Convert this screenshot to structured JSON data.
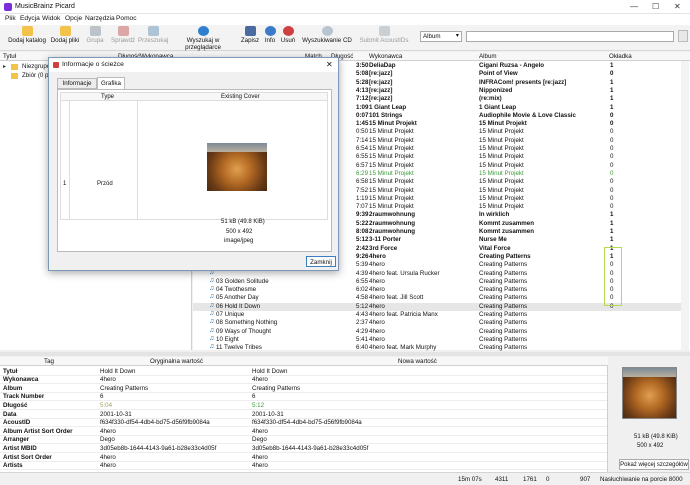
{
  "window": {
    "title": "MusicBrainz Picard"
  },
  "menu": [
    "Plik",
    "Edycja",
    "Widok",
    "Opcje",
    "Narzędzia",
    "Pomoc"
  ],
  "toolbar": {
    "add_folder": "Dodaj katalog",
    "add_files": "Dodaj pliki",
    "cluster": "Grupa",
    "lookup": "Sprawdź",
    "scan": "Przeszukaj",
    "browser_lookup": "Wyszukaj w przeglądarce",
    "save": "Zapisz",
    "info": "Info",
    "remove": "Usuń",
    "cd_lookup": "Wyszukiwanie CD",
    "submit_acoustid": "Submit AcoustIDs",
    "search_type": "Album",
    "search_value": ""
  },
  "left_panel": {
    "headers": [
      "Tytuł",
      "Długość",
      "Wykonawca"
    ],
    "items": [
      "Niezgrupo",
      "Zbiór (0 plików)"
    ]
  },
  "right_panel": {
    "headers": [
      "Tytuł",
      "Długość",
      "Wykonawca",
      "Album",
      "Okładka"
    ],
    "left_headers": [
      "Match",
      "Długość"
    ],
    "albums": [
      {
        "len": "3:50",
        "artist": "DeliaDap",
        "album": "Cigani Ruzsa - Angelo",
        "cover": "1",
        "bold": true
      },
      {
        "len": "5:08",
        "artist": "[re:jazz]",
        "album": "Point of View",
        "cover": "0",
        "bold": true
      },
      {
        "len": "5:28",
        "artist": "[re:jazz]",
        "album": "INFRACom! presents [re:jazz]",
        "cover": "1",
        "bold": true
      },
      {
        "len": "4:13",
        "artist": "[re:jazz]",
        "album": "Nipponized",
        "cover": "1",
        "bold": true
      },
      {
        "len": "7:12",
        "artist": "[re:jazz]",
        "album": "(re:mix)",
        "cover": "1",
        "bold": true
      },
      {
        "len": "1:09",
        "artist": "1 Giant Leap",
        "album": "1 Giant Leap",
        "cover": "1",
        "bold": true
      },
      {
        "len": "0:07",
        "artist": "101 Strings",
        "album": "Audiophile Movie & Love Classic",
        "cover": "0",
        "bold": true
      },
      {
        "len": "1:45",
        "artist": "15 Minut Projekt",
        "album": "15 Minut Projekt",
        "cover": "0",
        "bold": true
      },
      {
        "len": "0:50",
        "artist": "15 Minut Projekt",
        "album": "15 Minut Projekt",
        "cover": "0",
        "bold": false
      },
      {
        "len": "7:14",
        "artist": "15 Minut Projekt",
        "album": "15 Minut Projekt",
        "cover": "0",
        "bold": false
      },
      {
        "len": "6:54",
        "artist": "15 Minut Projekt",
        "album": "15 Minut Projekt",
        "cover": "0",
        "bold": false
      },
      {
        "len": "6:55",
        "artist": "15 Minut Projekt",
        "album": "15 Minut Projekt",
        "cover": "0",
        "bold": false
      },
      {
        "len": "6:57",
        "artist": "15 Minut Projekt",
        "album": "15 Minut Projekt",
        "cover": "0",
        "bold": false
      },
      {
        "len": "6:29",
        "artist": "15 Minut Projekt",
        "album": "15 Minut Projekt",
        "cover": "0",
        "green": true
      },
      {
        "len": "6:58",
        "artist": "15 Minut Projekt",
        "album": "15 Minut Projekt",
        "cover": "0",
        "bold": false
      },
      {
        "len": "7:52",
        "artist": "15 Minut Projekt",
        "album": "15 Minut Projekt",
        "cover": "0",
        "bold": false
      },
      {
        "len": "1:19",
        "artist": "15 Minut Projekt",
        "album": "15 Minut Projekt",
        "cover": "0",
        "bold": false
      },
      {
        "len": "7:07",
        "artist": "15 Minut Projekt",
        "album": "15 Minut Projekt",
        "cover": "0",
        "bold": false
      },
      {
        "len": "9:39",
        "artist": "2raumwohnung",
        "album": "In wirklich",
        "cover": "1",
        "bold": true
      },
      {
        "len": "5:22",
        "artist": "2raumwohnung",
        "album": "Kommt zusammen",
        "cover": "1",
        "bold": true
      },
      {
        "len": "8:08",
        "artist": "2raumwohnung",
        "album": "Kommt zusammen",
        "cover": "1",
        "bold": true
      },
      {
        "len": "5:12",
        "artist": "3-11 Porter",
        "album": "Nurse Me",
        "cover": "1",
        "bold": true
      },
      {
        "len": "2:42",
        "artist": "3rd Force",
        "album": "Vital Force",
        "cover": "1",
        "bold": true
      },
      {
        "len": "9:26",
        "artist": "4hero",
        "album": "Creating Patterns",
        "cover": "1",
        "bold": true
      }
    ],
    "tracks": [
      {
        "title": "",
        "len": "5:39",
        "artist": "4hero",
        "album": "Creating Patterns",
        "cover": "0"
      },
      {
        "title": "",
        "len": "4:39",
        "artist": "4hero feat. Ursula Rucker",
        "album": "Creating Patterns",
        "cover": "0"
      },
      {
        "title": "03  Golden Solitude",
        "len": "6:55",
        "artist": "4hero",
        "album": "Creating Patterns",
        "cover": "0"
      },
      {
        "title": "04  Twothesme",
        "len": "6:02",
        "artist": "4hero",
        "album": "Creating Patterns",
        "cover": "0"
      },
      {
        "title": "05  Another Day",
        "len": "4:58",
        "artist": "4hero feat. Jill Scott",
        "album": "Creating Patterns",
        "cover": "0"
      },
      {
        "title": "06  Hold It Down",
        "len": "5:12",
        "artist": "4hero",
        "album": "Creating Patterns",
        "cover": "0",
        "selected": true
      },
      {
        "title": "07  Unique",
        "len": "4:43",
        "artist": "4hero feat. Patricia Manx",
        "album": "Creating Patterns",
        "cover": ""
      },
      {
        "title": "08  Something Nothing",
        "len": "2:37",
        "artist": "4hero",
        "album": "Creating Patterns",
        "cover": ""
      },
      {
        "title": "09  Ways of Thought",
        "len": "4:29",
        "artist": "4hero",
        "album": "Creating Patterns",
        "cover": ""
      },
      {
        "title": "10  Eight",
        "len": "5:41",
        "artist": "4hero",
        "album": "Creating Patterns",
        "cover": ""
      },
      {
        "title": "11  Twelve Tribes",
        "len": "6:40",
        "artist": "4hero feat. Mark Murphy",
        "album": "Creating Patterns",
        "cover": ""
      }
    ]
  },
  "dialog": {
    "title": "Informacje o ścieżce",
    "tabs": [
      "Informacje",
      "Grafika"
    ],
    "col_type": "Type",
    "col_cover": "Existing Cover",
    "row_index": "1",
    "row_type": "Przód",
    "cover_size": "51 kB (49.8 KiB)",
    "cover_dims": "500 x 492",
    "cover_mime": "image/jpeg",
    "close": "Zamknij"
  },
  "metadata": {
    "headers": [
      "Tag",
      "Oryginalna wartość",
      "Nowa wartość"
    ],
    "rows": [
      [
        "Tytuł",
        "Hold It Down",
        "Hold It Down"
      ],
      [
        "Wykonawca",
        "4hero",
        "4hero"
      ],
      [
        "Album",
        "Creating Patterns",
        "Creating Patterns"
      ],
      [
        "Track Number",
        "6",
        "6"
      ],
      [
        "Długość",
        "5:04",
        "5:12"
      ],
      [
        "Data",
        "2001-10-31",
        "2001-10-31"
      ],
      [
        "AcoustID",
        "f634f330-df54-4db4-bd75-d56f9fb9084a",
        "f634f330-df54-4db4-bd75-d56f9fb9084a"
      ],
      [
        "Album Artist Sort Order",
        "4hero",
        "4hero"
      ],
      [
        "Arranger",
        "Dego",
        "Dego"
      ],
      [
        "Artist MBID",
        "3d05eb8b-1644-4143-9a61-b28e33c4d05f",
        "3d05eb8b-1644-4143-9a61-b28e33c4d05f"
      ],
      [
        "Artist Sort Order",
        "4hero",
        "4hero"
      ],
      [
        "Artists",
        "4hero",
        "4hero"
      ]
    ]
  },
  "cover_panel": {
    "size": "51 kB (49.8 KiB)",
    "dims": "500 x 492",
    "button": "Pokaż więcej szczegółów"
  },
  "status": {
    "duration": "15m 07s",
    "files": "4311",
    "pending": "1761",
    "tags": "0",
    "requests": "907",
    "listen": "Nasłuchiwanie na porcie 8000"
  },
  "colors": {
    "accent": "#1f6f9f",
    "green": "#3a9a3a",
    "highlight": "#b7d94d"
  }
}
